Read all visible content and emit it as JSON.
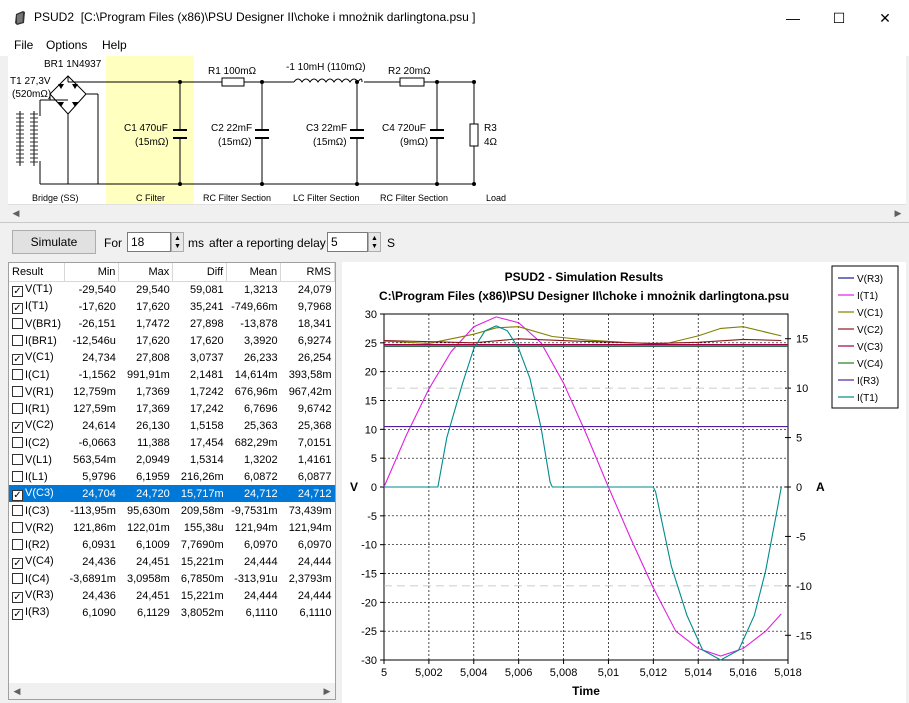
{
  "window": {
    "app_name": "PSUD2",
    "file_path": "[C:\\Program Files (x86)\\PSU Designer II\\choke i mnożnik darlingtona.psu ]",
    "min_glyph": "—",
    "max_glyph": "☐",
    "close_glyph": "✕"
  },
  "menu": [
    "File",
    "Options",
    "Help"
  ],
  "schematic": {
    "transformer_label": "T1 27,3V",
    "transformer_res": "(520mΩ)",
    "bridge_label": "BR1 1N4937",
    "c1_label": "C1 470uF",
    "c1_res": "(15mΩ)",
    "r1_label": "R1 100mΩ",
    "c2_label": "C2 22mF",
    "c2_res": "(15mΩ)",
    "l1_label": "-1 10mH (110mΩ)",
    "c3_label": "C3 22mF",
    "c3_res": "(15mΩ)",
    "r2_label": "R2 20mΩ",
    "c4_label": "C4 720uF",
    "c4_res": "(9mΩ)",
    "r3_label": "R3",
    "r3_value": "4Ω",
    "sections": [
      "Bridge (SS)",
      "C Filter",
      "RC Filter Section",
      "LC Filter Section",
      "RC Filter Section",
      "Load"
    ]
  },
  "toolbar": {
    "simulate_label": "Simulate",
    "for_label": "For",
    "for_value": "18",
    "ms_label": "ms",
    "delay_label": "after a reporting delay of",
    "delay_value": "5",
    "s_label": "S"
  },
  "table": {
    "headers": [
      "Result",
      "Min",
      "Max",
      "Diff",
      "Mean",
      "RMS"
    ],
    "rows": [
      {
        "checked": true,
        "name": "V(T1)",
        "min": "-29,540",
        "max": "29,540",
        "diff": "59,081",
        "mean": "1,3213",
        "rms": "24,079"
      },
      {
        "checked": true,
        "name": "I(T1)",
        "min": "-17,620",
        "max": "17,620",
        "diff": "35,241",
        "mean": "-749,66m",
        "rms": "9,7968"
      },
      {
        "checked": false,
        "name": "V(BR1)",
        "min": "-26,151",
        "max": "1,7472",
        "diff": "27,898",
        "mean": "-13,878",
        "rms": "18,341"
      },
      {
        "checked": false,
        "name": "I(BR1)",
        "min": "-12,546u",
        "max": "17,620",
        "diff": "17,620",
        "mean": "3,3920",
        "rms": "6,9274"
      },
      {
        "checked": true,
        "name": "V(C1)",
        "min": "24,734",
        "max": "27,808",
        "diff": "3,0737",
        "mean": "26,233",
        "rms": "26,254"
      },
      {
        "checked": false,
        "name": "I(C1)",
        "min": "-1,1562",
        "max": "991,91m",
        "diff": "2,1481",
        "mean": "14,614m",
        "rms": "393,58m"
      },
      {
        "checked": false,
        "name": "V(R1)",
        "min": "12,759m",
        "max": "1,7369",
        "diff": "1,7242",
        "mean": "676,96m",
        "rms": "967,42m"
      },
      {
        "checked": false,
        "name": "I(R1)",
        "min": "127,59m",
        "max": "17,369",
        "diff": "17,242",
        "mean": "6,7696",
        "rms": "9,6742"
      },
      {
        "checked": true,
        "name": "V(C2)",
        "min": "24,614",
        "max": "26,130",
        "diff": "1,5158",
        "mean": "25,363",
        "rms": "25,368"
      },
      {
        "checked": false,
        "name": "I(C2)",
        "min": "-6,0663",
        "max": "11,388",
        "diff": "17,454",
        "mean": "682,29m",
        "rms": "7,0151"
      },
      {
        "checked": false,
        "name": "V(L1)",
        "min": "563,54m",
        "max": "2,0949",
        "diff": "1,5314",
        "mean": "1,3202",
        "rms": "1,4161"
      },
      {
        "checked": false,
        "name": "I(L1)",
        "min": "5,9796",
        "max": "6,1959",
        "diff": "216,26m",
        "mean": "6,0872",
        "rms": "6,0877"
      },
      {
        "checked": true,
        "name": "V(C3)",
        "min": "24,704",
        "max": "24,720",
        "diff": "15,717m",
        "mean": "24,712",
        "rms": "24,712",
        "selected": true
      },
      {
        "checked": false,
        "name": "I(C3)",
        "min": "-113,95m",
        "max": "95,630m",
        "diff": "209,58m",
        "mean": "-9,7531m",
        "rms": "73,439m"
      },
      {
        "checked": false,
        "name": "V(R2)",
        "min": "121,86m",
        "max": "122,01m",
        "diff": "155,38u",
        "mean": "121,94m",
        "rms": "121,94m"
      },
      {
        "checked": false,
        "name": "I(R2)",
        "min": "6,0931",
        "max": "6,1009",
        "diff": "7,7690m",
        "mean": "6,0970",
        "rms": "6,0970"
      },
      {
        "checked": true,
        "name": "V(C4)",
        "min": "24,436",
        "max": "24,451",
        "diff": "15,221m",
        "mean": "24,444",
        "rms": "24,444"
      },
      {
        "checked": false,
        "name": "I(C4)",
        "min": "-3,6891m",
        "max": "3,0958m",
        "diff": "6,7850m",
        "mean": "-313,91u",
        "rms": "2,3793m"
      },
      {
        "checked": true,
        "name": "V(R3)",
        "min": "24,436",
        "max": "24,451",
        "diff": "15,221m",
        "mean": "24,444",
        "rms": "24,444"
      },
      {
        "checked": true,
        "name": "I(R3)",
        "min": "6,1090",
        "max": "6,1129",
        "diff": "3,8052m",
        "mean": "6,1110",
        "rms": "6,1110"
      }
    ]
  },
  "chart_data": {
    "type": "line",
    "title": "PSUD2 - Simulation Results",
    "subtitle": "C:\\Program Files (x86)\\PSU Designer II\\choke i mnożnik darlingtona.psu",
    "xlabel": "Time",
    "ylabel_left": "V",
    "ylabel_right": "A",
    "xlim": [
      5,
      5.018
    ],
    "ylim_left": [
      -30,
      30
    ],
    "ylim_right": [
      -17.5,
      17.5
    ],
    "x_ticks": [
      "5",
      "5,002",
      "5,004",
      "5,006",
      "5,008",
      "5,01",
      "5,012",
      "5,014",
      "5,016",
      "5,018"
    ],
    "y_left_ticks": [
      "30",
      "25",
      "20",
      "15",
      "10",
      "5",
      "0",
      "-5",
      "-10",
      "-15",
      "-20",
      "-25",
      "-30"
    ],
    "y_right_ticks": [
      "15",
      "10",
      "5",
      "0",
      "-5",
      "-10",
      "-15"
    ],
    "grid": true,
    "legend_placement": "right",
    "series": [
      {
        "name": "V(R3)",
        "axis": "left",
        "color": "#1a1a8c",
        "x": [
          5,
          5.018
        ],
        "y": [
          24.44,
          24.44
        ]
      },
      {
        "name": "I(T1)",
        "axis": "left",
        "color": "#e020e0",
        "x": [
          5,
          5.001,
          5.002,
          5.003,
          5.004,
          5.005,
          5.006,
          5.007,
          5.008,
          5.009,
          5.01,
          5.011,
          5.012,
          5.013,
          5.014,
          5.015,
          5.016,
          5.017,
          5.0177
        ],
        "y": [
          0,
          9,
          17,
          23.5,
          27.8,
          29.5,
          28.5,
          25,
          18,
          9.3,
          0,
          -9,
          -17.5,
          -25,
          -28,
          -29.3,
          -28,
          -25,
          -22
        ]
      },
      {
        "name": "V(C1)",
        "axis": "left",
        "color": "#808000",
        "x": [
          5,
          5.002,
          5.004,
          5.005,
          5.006,
          5.0075,
          5.009,
          5.011,
          5.0125,
          5.014,
          5.015,
          5.016,
          5.0177
        ],
        "y": [
          25.3,
          24.9,
          26.5,
          27.6,
          27.8,
          26.1,
          25.5,
          25.0,
          24.8,
          26.2,
          27.5,
          27.8,
          26.2
        ]
      },
      {
        "name": "V(C2)",
        "axis": "left",
        "color": "#8b1a1a",
        "x": [
          5,
          5.004,
          5.006,
          5.0085,
          5.012,
          5.014,
          5.016,
          5.0177
        ],
        "y": [
          25.4,
          25.0,
          25.7,
          25.3,
          24.9,
          25.1,
          25.6,
          25.4
        ]
      },
      {
        "name": "V(C3)",
        "axis": "left",
        "color": "#a0004a",
        "x": [
          5,
          5.018
        ],
        "y": [
          24.71,
          24.71
        ]
      },
      {
        "name": "V(C4)",
        "axis": "left",
        "color": "#208020",
        "x": [
          5,
          5.018
        ],
        "y": [
          24.44,
          24.44
        ]
      },
      {
        "name": "I(R3)",
        "axis": "right",
        "color": "#5020a0",
        "x": [
          5,
          5.018
        ],
        "y": [
          6.11,
          6.11
        ]
      },
      {
        "name": "I(T1)",
        "axis": "right",
        "color": "#008b8b",
        "x": [
          5,
          5.0024,
          5.0028,
          5.0035,
          5.004,
          5.0045,
          5.005,
          5.0055,
          5.006,
          5.0065,
          5.007,
          5.0074,
          5.0075,
          5.012,
          5.0121,
          5.0128,
          5.0135,
          5.0142,
          5.015,
          5.0158,
          5.0165,
          5.017,
          5.0175,
          5.0177
        ],
        "y": [
          0,
          0,
          5,
          10.5,
          14,
          15.8,
          16.3,
          15.8,
          14,
          11,
          6,
          0.5,
          0,
          0,
          -0.5,
          -8,
          -13,
          -16.5,
          -17.5,
          -16.5,
          -13,
          -8.5,
          -2.5,
          0
        ]
      }
    ]
  }
}
